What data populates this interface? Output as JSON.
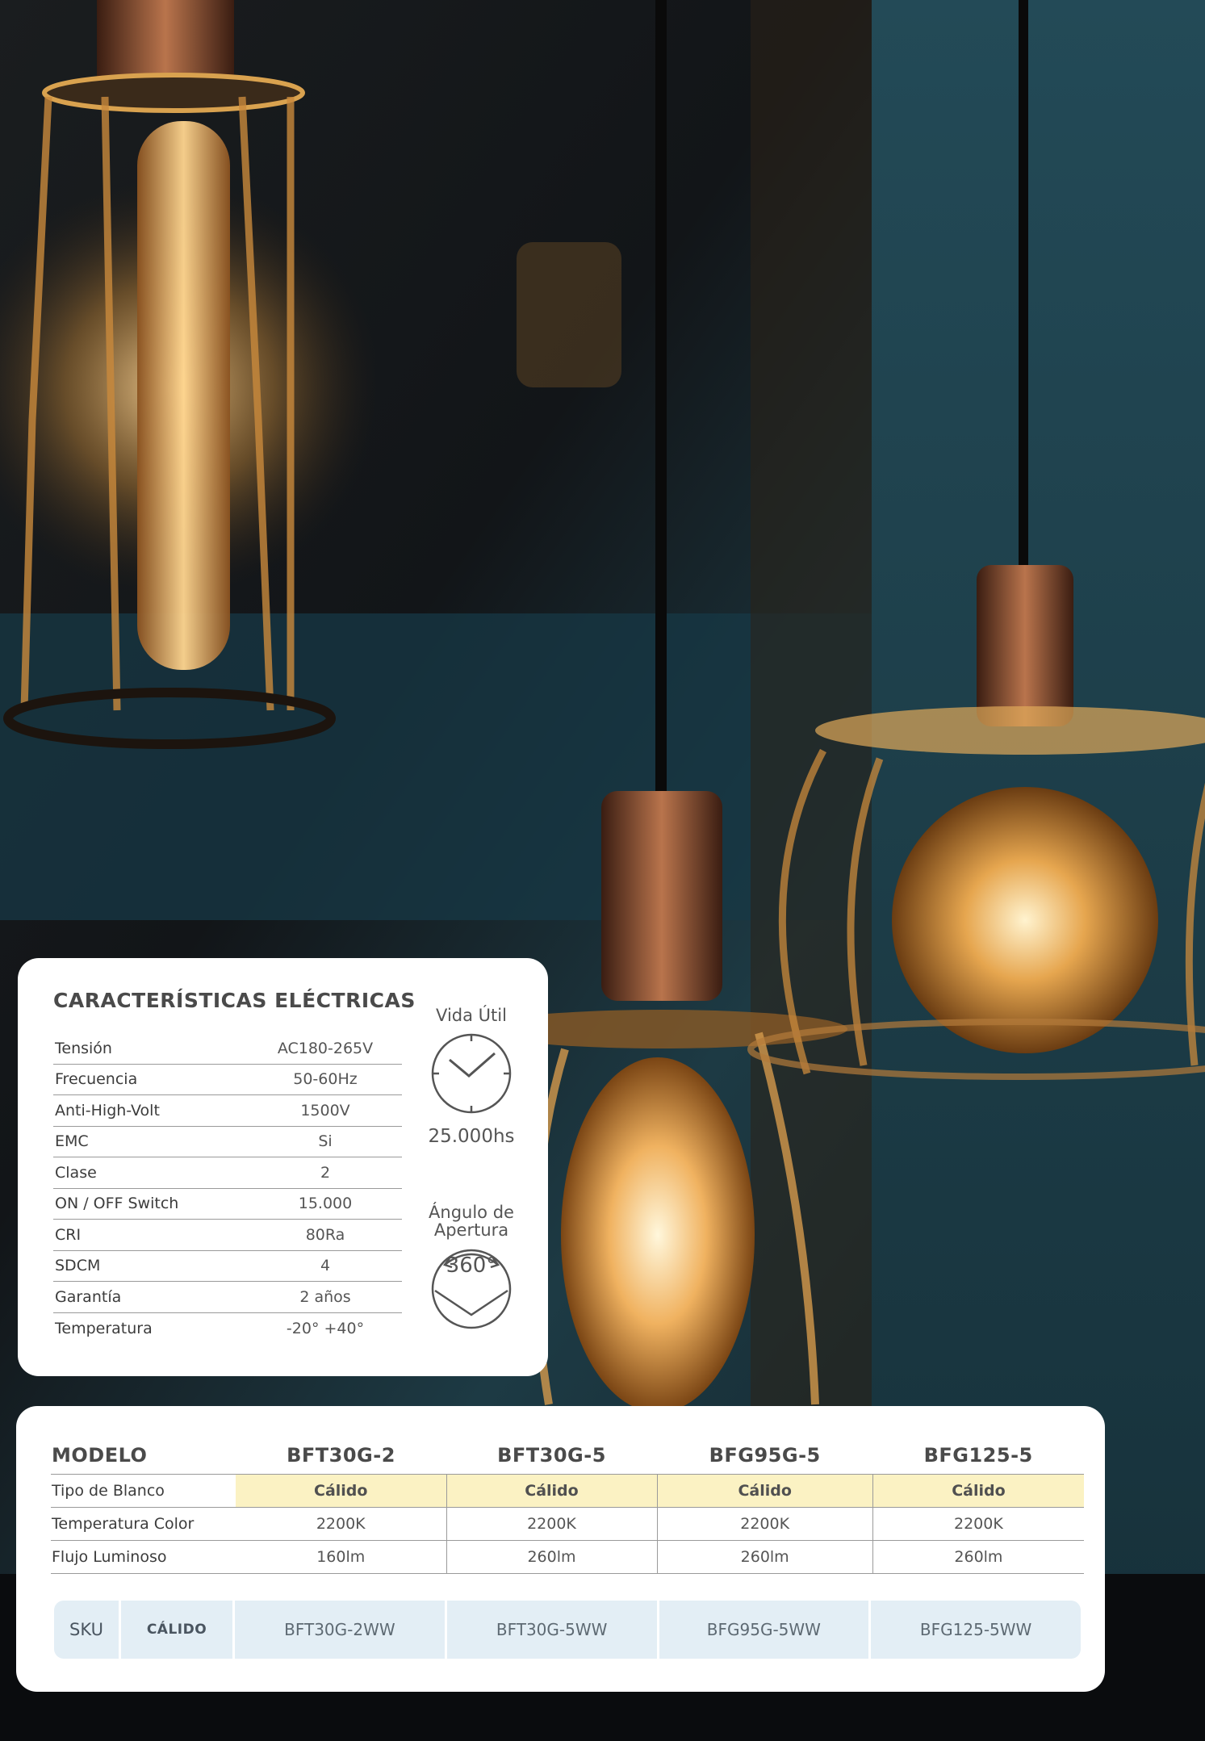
{
  "electrical": {
    "title": "CARACTERÍSTICAS ELÉCTRICAS",
    "specs": [
      {
        "label": "Tensión",
        "value": "AC180-265V"
      },
      {
        "label": "Frecuencia",
        "value": "50-60Hz"
      },
      {
        "label": "Anti-High-Volt",
        "value": "1500V"
      },
      {
        "label": "EMC",
        "value": "Si"
      },
      {
        "label": "Clase",
        "value": "2"
      },
      {
        "label": "ON / OFF Switch",
        "value": "15.000"
      },
      {
        "label": "CRI",
        "value": "80Ra"
      },
      {
        "label": "SDCM",
        "value": "4"
      },
      {
        "label": "Garantía",
        "value": "2 años"
      },
      {
        "label": "Temperatura",
        "value": "-20° +40°"
      }
    ],
    "lifespan": {
      "caption": "Vida Útil",
      "value": "25.000hs",
      "icon": "clock-icon"
    },
    "beam_angle": {
      "caption_line1": "Ángulo de",
      "caption_line2": "Apertura",
      "value": "360°",
      "icon": "beam-angle-icon"
    }
  },
  "models": {
    "header_label": "MODELO",
    "names": [
      "BFT30G-2",
      "BFT30G-5",
      "BFG95G-5",
      "BFG125-5"
    ],
    "rows": [
      {
        "label": "Tipo de Blanco",
        "values": [
          "Cálido",
          "Cálido",
          "Cálido",
          "Cálido"
        ]
      },
      {
        "label": "Temperatura Color",
        "values": [
          "2200K",
          "2200K",
          "2200K",
          "2200K"
        ]
      },
      {
        "label": "Flujo Luminoso",
        "values": [
          "160lm",
          "260lm",
          "260lm",
          "260lm"
        ]
      }
    ],
    "warm_highlight": "#fbf2c3"
  },
  "sku": {
    "label": "SKU",
    "type": "CÁLIDO",
    "values": [
      "BFT30G-2WW",
      "BFT30G-5WW",
      "BFG95G-5WW",
      "BFG125-5WW"
    ],
    "color": "#e3eef5"
  }
}
